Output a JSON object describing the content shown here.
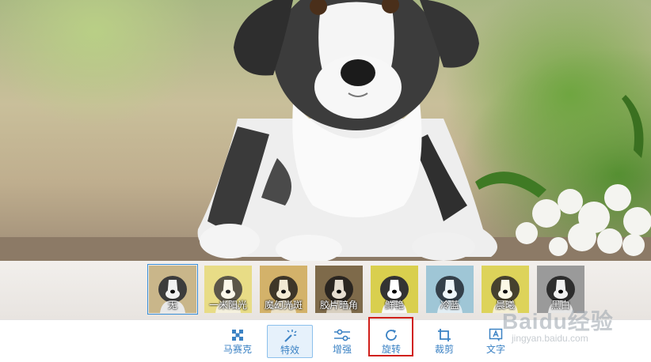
{
  "filters": [
    {
      "label": "无",
      "selected": true,
      "tint": "#c9b68a"
    },
    {
      "label": "一米阳光",
      "selected": false,
      "tint": "#e8dc86"
    },
    {
      "label": "魔幻光斑",
      "selected": false,
      "tint": "#d3b26a"
    },
    {
      "label": "胶片暗角",
      "selected": false,
      "tint": "#7e6a4a"
    },
    {
      "label": "鲜艳",
      "selected": false,
      "tint": "#d9cf4e"
    },
    {
      "label": "冷蓝",
      "selected": false,
      "tint": "#9fc6d6"
    },
    {
      "label": "晨曦",
      "selected": false,
      "tint": "#ddd35a"
    },
    {
      "label": "黑白",
      "selected": false,
      "tint": "#9a9a9a"
    }
  ],
  "toolbar": [
    {
      "label": "马赛克",
      "icon": "mosaic-icon",
      "active": false
    },
    {
      "label": "特效",
      "icon": "magic-wand-icon",
      "active": true
    },
    {
      "label": "增强",
      "icon": "sliders-icon",
      "active": false
    },
    {
      "label": "旋转",
      "icon": "rotate-icon",
      "active": false
    },
    {
      "label": "裁剪",
      "icon": "crop-icon",
      "active": false
    },
    {
      "label": "文字",
      "icon": "text-icon",
      "active": false
    }
  ],
  "watermark": {
    "logo": "Baidu经验",
    "url": "jingyan.baidu.com"
  },
  "colors": {
    "accent": "#3b82c4",
    "highlight": "#d0201a"
  }
}
